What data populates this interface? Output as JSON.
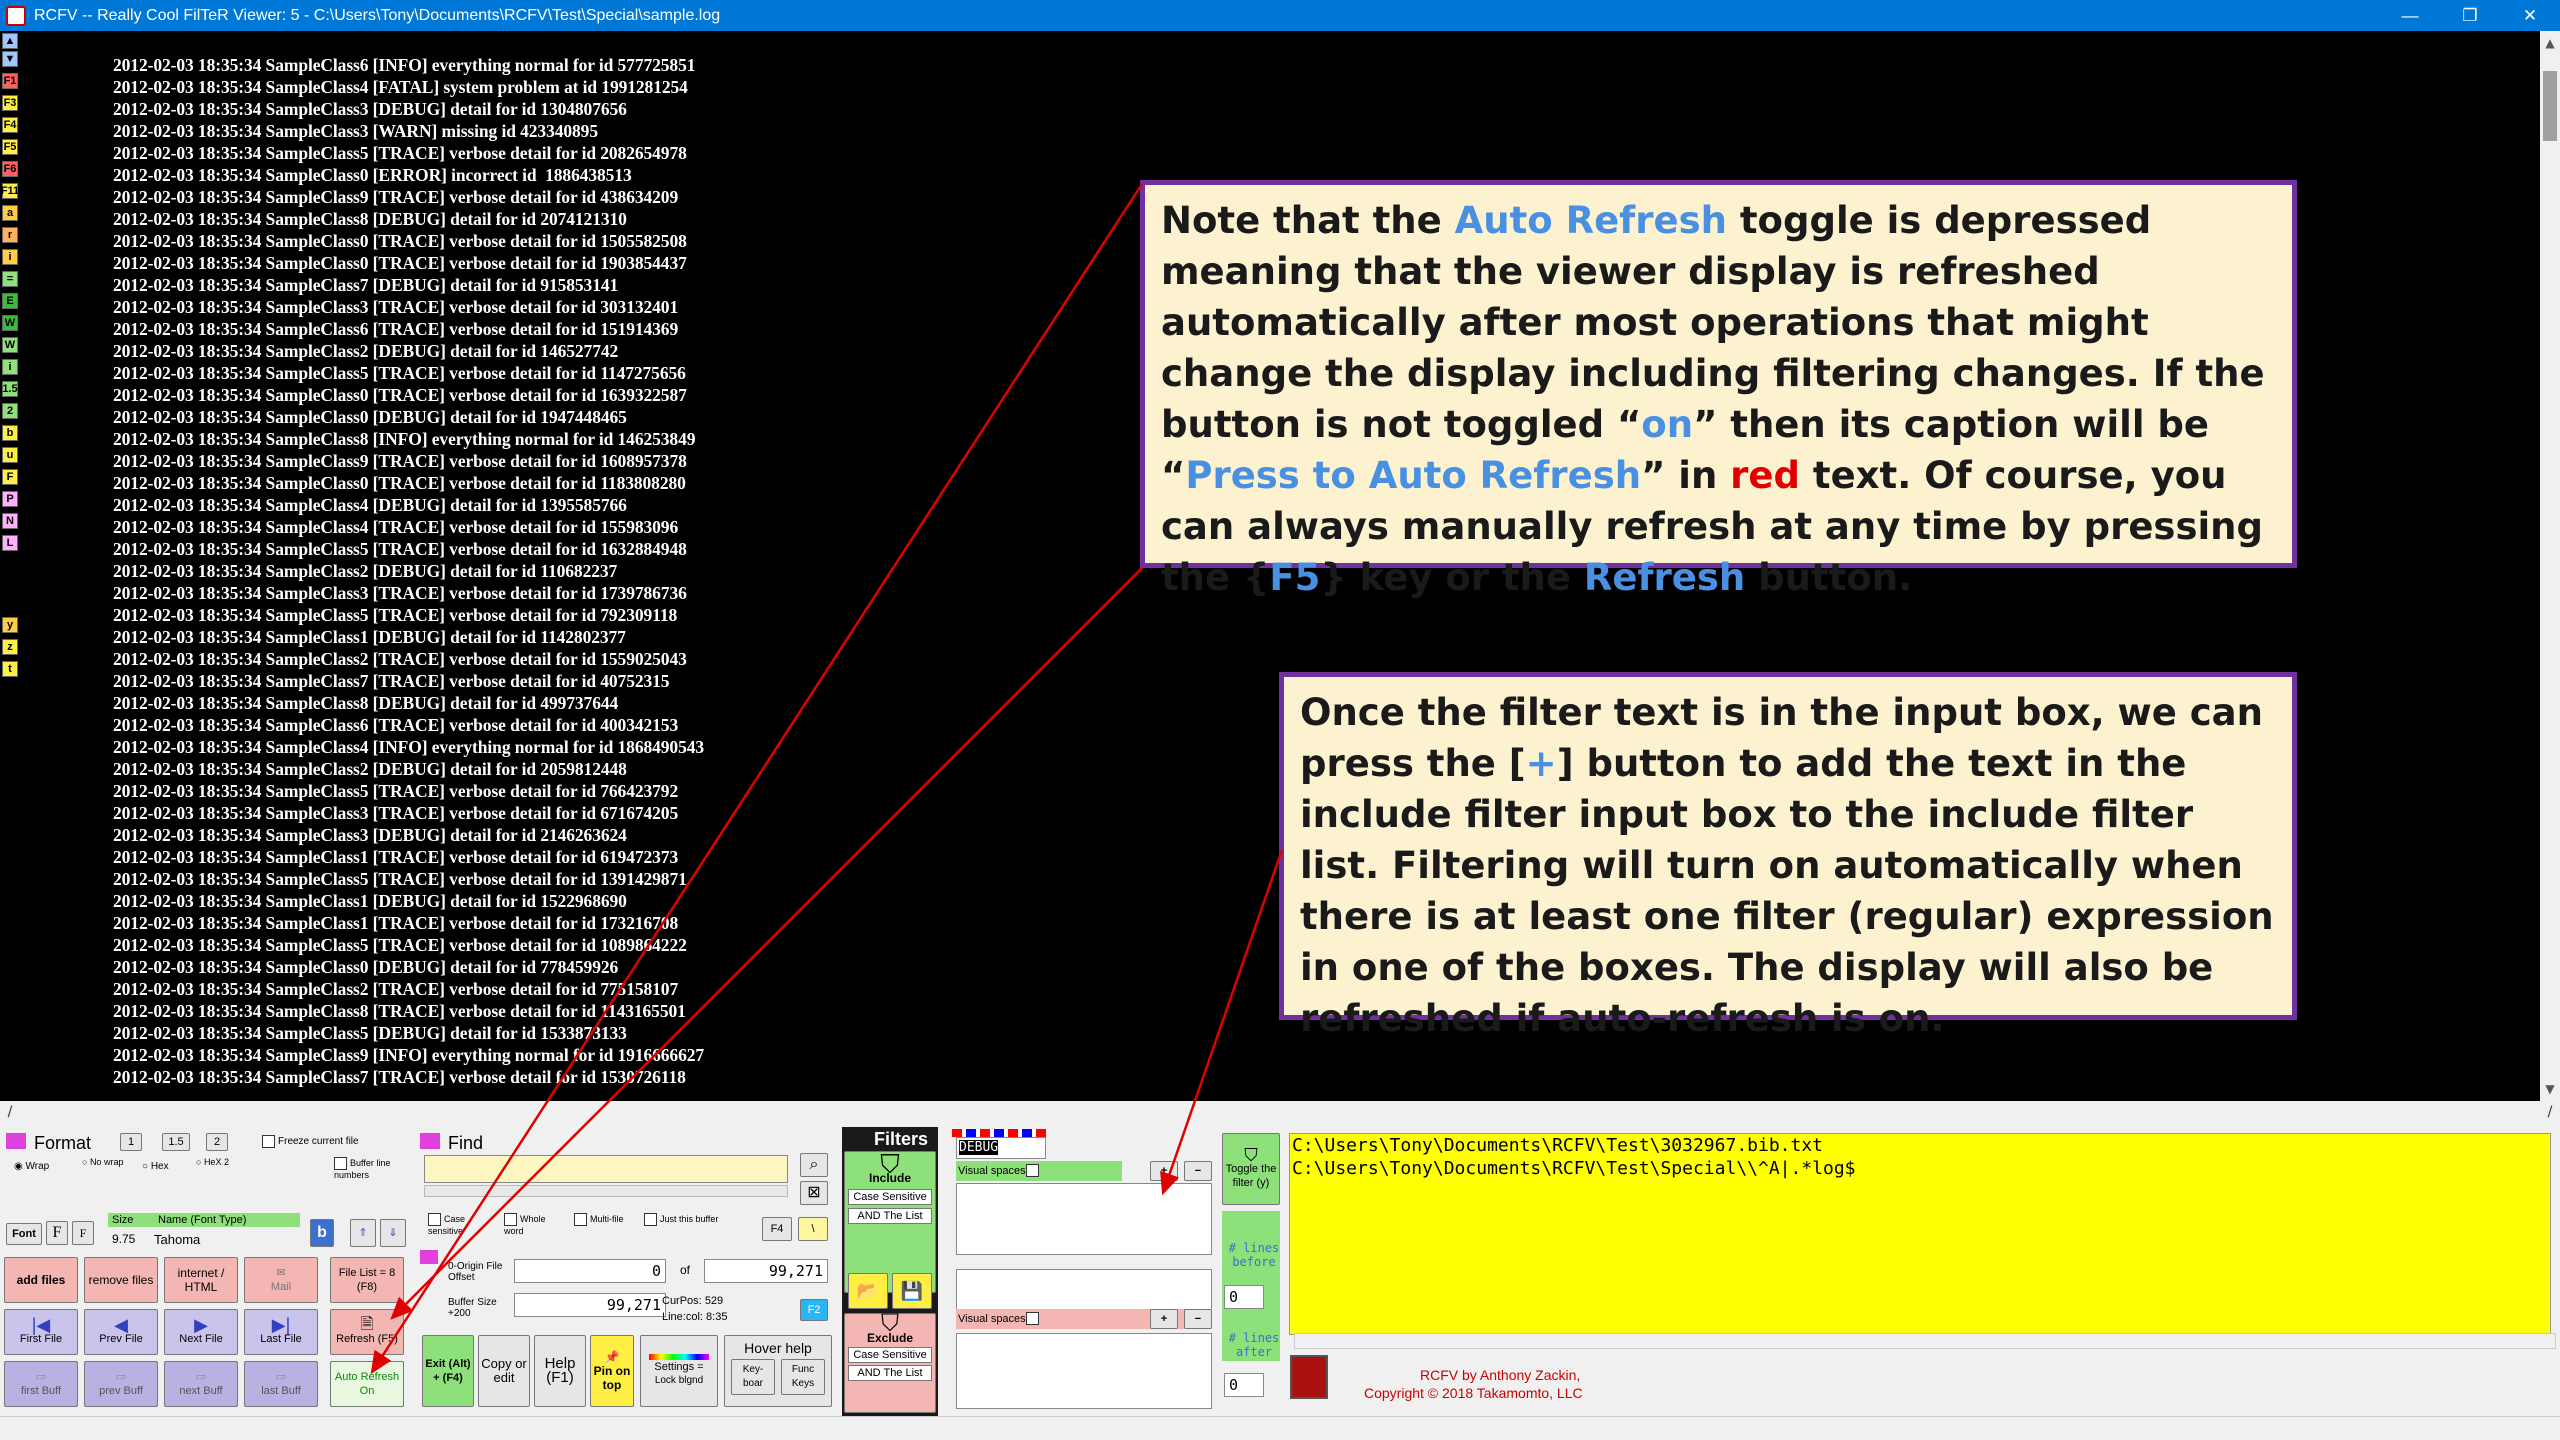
{
  "window": {
    "title": "RCFV -- Really Cool FilTeR Viewer: 5 - C:\\Users\\Tony\\Documents\\RCFV\\Test\\Special\\sample.log",
    "minimize": "—",
    "restore": "❐",
    "close": "✕"
  },
  "left_strip": [
    "F1",
    "F3",
    "F4",
    "F5",
    "F6",
    "F11",
    "a",
    "r",
    "i",
    "=",
    "E",
    "W",
    "W",
    "i",
    "1.5",
    "2",
    "b",
    "u",
    "F",
    "P",
    "N",
    "L",
    "y",
    "z",
    "t"
  ],
  "log_lines": [
    "2012-02-03 18:35:34 SampleClass6 [INFO] everything normal for id 577725851",
    "2012-02-03 18:35:34 SampleClass4 [FATAL] system problem at id 1991281254",
    "2012-02-03 18:35:34 SampleClass3 [DEBUG] detail for id 1304807656",
    "2012-02-03 18:35:34 SampleClass3 [WARN] missing id 423340895",
    "2012-02-03 18:35:34 SampleClass5 [TRACE] verbose detail for id 2082654978",
    "2012-02-03 18:35:34 SampleClass0 [ERROR] incorrect id  1886438513",
    "2012-02-03 18:35:34 SampleClass9 [TRACE] verbose detail for id 438634209",
    "2012-02-03 18:35:34 SampleClass8 [DEBUG] detail for id 2074121310",
    "2012-02-03 18:35:34 SampleClass0 [TRACE] verbose detail for id 1505582508",
    "2012-02-03 18:35:34 SampleClass0 [TRACE] verbose detail for id 1903854437",
    "2012-02-03 18:35:34 SampleClass7 [DEBUG] detail for id 915853141",
    "2012-02-03 18:35:34 SampleClass3 [TRACE] verbose detail for id 303132401",
    "2012-02-03 18:35:34 SampleClass6 [TRACE] verbose detail for id 151914369",
    "2012-02-03 18:35:34 SampleClass2 [DEBUG] detail for id 146527742",
    "2012-02-03 18:35:34 SampleClass5 [TRACE] verbose detail for id 1147275656",
    "2012-02-03 18:35:34 SampleClass0 [TRACE] verbose detail for id 1639322587",
    "2012-02-03 18:35:34 SampleClass0 [DEBUG] detail for id 1947448465",
    "2012-02-03 18:35:34 SampleClass8 [INFO] everything normal for id 146253849",
    "2012-02-03 18:35:34 SampleClass9 [TRACE] verbose detail for id 1608957378",
    "2012-02-03 18:35:34 SampleClass0 [TRACE] verbose detail for id 1183808280",
    "2012-02-03 18:35:34 SampleClass4 [DEBUG] detail for id 1395585766",
    "2012-02-03 18:35:34 SampleClass4 [TRACE] verbose detail for id 155983096",
    "2012-02-03 18:35:34 SampleClass5 [TRACE] verbose detail for id 1632884948",
    "2012-02-03 18:35:34 SampleClass2 [DEBUG] detail for id 110682237",
    "2012-02-03 18:35:34 SampleClass3 [TRACE] verbose detail for id 1739786736",
    "2012-02-03 18:35:34 SampleClass5 [TRACE] verbose detail for id 792309118",
    "2012-02-03 18:35:34 SampleClass1 [DEBUG] detail for id 1142802377",
    "2012-02-03 18:35:34 SampleClass2 [TRACE] verbose detail for id 1559025043",
    "2012-02-03 18:35:34 SampleClass7 [TRACE] verbose detail for id 40752315",
    "2012-02-03 18:35:34 SampleClass8 [DEBUG] detail for id 499737644",
    "2012-02-03 18:35:34 SampleClass6 [TRACE] verbose detail for id 400342153",
    "2012-02-03 18:35:34 SampleClass4 [INFO] everything normal for id 1868490543",
    "2012-02-03 18:35:34 SampleClass2 [DEBUG] detail for id 2059812448",
    "2012-02-03 18:35:34 SampleClass5 [TRACE] verbose detail for id 766423792",
    "2012-02-03 18:35:34 SampleClass3 [TRACE] verbose detail for id 671674205",
    "2012-02-03 18:35:34 SampleClass3 [DEBUG] detail for id 2146263624",
    "2012-02-03 18:35:34 SampleClass1 [TRACE] verbose detail for id 619472373",
    "2012-02-03 18:35:34 SampleClass5 [TRACE] verbose detail for id 1391429871",
    "2012-02-03 18:35:34 SampleClass1 [DEBUG] detail for id 1522968690",
    "2012-02-03 18:35:34 SampleClass1 [TRACE] verbose detail for id 173216708",
    "2012-02-03 18:35:34 SampleClass5 [TRACE] verbose detail for id 1089864222",
    "2012-02-03 18:35:34 SampleClass0 [DEBUG] detail for id 778459926",
    "2012-02-03 18:35:34 SampleClass2 [TRACE] verbose detail for id 775158107",
    "2012-02-03 18:35:34 SampleClass8 [TRACE] verbose detail for id 1143165501",
    "2012-02-03 18:35:34 SampleClass5 [DEBUG] detail for id 1533873133",
    "2012-02-03 18:35:34 SampleClass9 [INFO] everything normal for id 1916666627",
    "2012-02-03 18:35:34 SampleClass7 [TRACE] verbose detail for id 1530726118"
  ],
  "callout1": {
    "p1": "Note that the ",
    "auto_refresh": "Auto Refresh",
    "p2": " toggle is depressed meaning that the viewer display is refreshed automatically after most operations that might change the display including filtering changes. If the button is not toggled “",
    "on": "on",
    "p3": "” then its caption will be “",
    "press": "Press to Auto Refresh",
    "p4": "” in ",
    "red": "red",
    "p5": " text. Of course, you can always manually refresh at any time by pressing the {",
    "f5": "F5",
    "p6": "} key or the ",
    "refresh": "Refresh",
    "p7": " button."
  },
  "callout2": {
    "p1": "Once the filter text is in the input box, we can press the [",
    "plus": "+",
    "p2": "] button to add the text in the include filter input box to the include filter list.  Filtering will turn on automatically when there is at least one filter (regular) expression in one of the boxes. The display will also be refreshed if auto-refresh is on."
  },
  "format": {
    "title": "Format",
    "w1": "1",
    "w15": "1.5",
    "w2": "2",
    "freeze": "Freeze current file",
    "wrap": "Wrap",
    "nowrap": "No wrap",
    "hex": "Hex",
    "hex2": "HeX 2",
    "buffer_line_numbers": "Buffer line numbers",
    "font": "Font",
    "size_label": "Size",
    "size_value": "9.75",
    "name_label": "Name (Font Type)",
    "font_name": "Tahoma",
    "bold": "b"
  },
  "find": {
    "title": "Find",
    "case_sensitive": "Case sensitive",
    "whole_word": "Whole word",
    "multi_file": "Multi-file",
    "just_buffer": "Just this buffer",
    "f4": "F4",
    "origin_label": "0-Origin File Offset",
    "origin_value": "0",
    "of": "of",
    "of_value": "99,271",
    "buffer_size_label": "Buffer Size +200",
    "buffer_size_value": "99,271",
    "curpos_label": "CurPos:",
    "curpos_value": "529",
    "linecol_label": "Line:col:",
    "linecol_value": "8:35",
    "f2": "F2"
  },
  "buttons": {
    "add_files": "add files",
    "remove_files": "remove files",
    "internet_html": "internet / HTML",
    "mail": "Mail",
    "file_list": "File List = 8 (F8)",
    "first_file": "First File",
    "prev_file": "Prev File",
    "next_file": "Next File",
    "last_file": "Last File",
    "refresh": "Refresh (F5)",
    "first_buff": "first Buff",
    "prev_buff": "prev Buff",
    "next_buff": "next Buff",
    "last_buff": "last Buff",
    "auto_refresh": "Auto Refresh",
    "auto_refresh_state": "On",
    "exit": "Exit (Alt) + (F4)",
    "copy_edit": "Copy or edit",
    "help": "Help (F1)",
    "pin_on_top": "Pin on top",
    "settings": "Settings =",
    "lock_blgnd": "Lock blgnd",
    "hover_help": "Hover help",
    "keyboard": "Key-boar",
    "func_keys": "Func Keys"
  },
  "filters": {
    "title": "Filters",
    "include": "Include",
    "exclude": "Exclude",
    "case_sensitive": "Case Sensitive",
    "and_the_list": "AND The List",
    "include_input": "DEBUG",
    "visual_spaces": "Visual spaces?",
    "toggle_filter": "Toggle the filter (y)",
    "lines_before": "# lines before",
    "lines_before_value": "0",
    "lines_after": "# lines after",
    "lines_after_value": "0"
  },
  "file_list_pane": [
    "C:\\Users\\Tony\\Documents\\RCFV\\Test\\3032967.bib.txt",
    "C:\\Users\\Tony\\Documents\\RCFV\\Test\\Special\\\\^A|.*log$"
  ],
  "credits": {
    "line1": "RCFV by Anthony Zackin,",
    "line2": "Copyright © 2018 Takamomto, LLC"
  },
  "colors": {
    "callout_border": "#7030a0",
    "callout_bg": "#fdf2d0",
    "highlight_blue": "#4a90e2",
    "highlight_red": "#e00000",
    "arrow": "#e00000",
    "titlebar": "#0078d7"
  }
}
